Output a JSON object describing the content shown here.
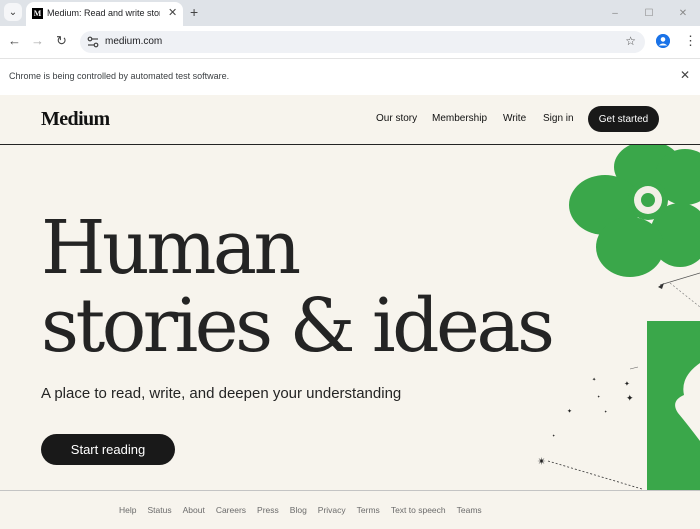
{
  "browser": {
    "tab_title": "Medium: Read and write stories",
    "favicon_letter": "M",
    "url": "medium.com",
    "infobar_text": "Chrome is being controlled by automated test software."
  },
  "header": {
    "logo": "Medium",
    "nav": [
      "Our story",
      "Membership",
      "Write",
      "Sign in"
    ],
    "cta": "Get started"
  },
  "hero": {
    "headline_line1": "Human",
    "headline_line2": "stories & ideas",
    "subtitle": "A place to read, write, and deepen your understanding",
    "cta": "Start reading"
  },
  "footer": {
    "links": [
      "Help",
      "Status",
      "About",
      "Careers",
      "Press",
      "Blog",
      "Privacy",
      "Terms",
      "Text to speech",
      "Teams"
    ]
  },
  "colors": {
    "background": "#f7f4ed",
    "button": "#191919",
    "accent_green": "#3aa74a"
  },
  "icons": [
    "tab-search-icon",
    "close-icon",
    "plus-icon",
    "minimize-icon",
    "maximize-icon",
    "back-icon",
    "forward-icon",
    "reload-icon",
    "site-info-icon",
    "star-icon",
    "profile-icon",
    "menu-icon"
  ]
}
